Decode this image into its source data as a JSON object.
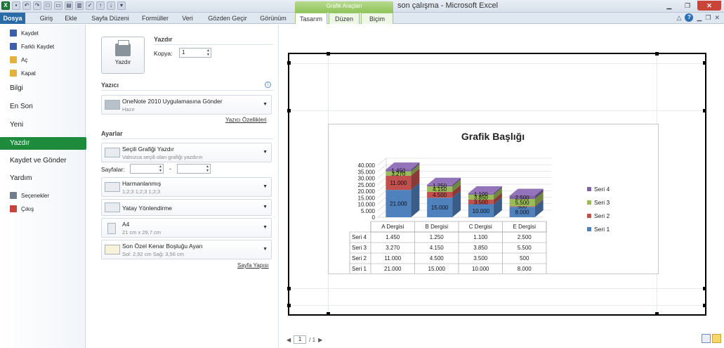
{
  "titlebar": {
    "context_group": "Grafik Araçları",
    "window_title": "son çalışma - Microsoft Excel"
  },
  "tabs": [
    {
      "label": "Dosya"
    },
    {
      "label": "Giriş"
    },
    {
      "label": "Ekle"
    },
    {
      "label": "Sayfa Düzeni"
    },
    {
      "label": "Formüller"
    },
    {
      "label": "Veri"
    },
    {
      "label": "Gözden Geçir"
    },
    {
      "label": "Görünüm"
    },
    {
      "label": "Tasarım"
    },
    {
      "label": "Düzen"
    },
    {
      "label": "Biçim"
    }
  ],
  "leftmenu": {
    "small_items": [
      {
        "label": "Kaydet",
        "icon": "save-icon",
        "color": "#3b5fa8"
      },
      {
        "label": "Farklı Kaydet",
        "icon": "save-as-icon",
        "color": "#3b5fa8"
      },
      {
        "label": "Aç",
        "icon": "open-folder-icon",
        "color": "#e3b23c"
      },
      {
        "label": "Kapat",
        "icon": "close-folder-icon",
        "color": "#e3b23c"
      }
    ],
    "big_items": [
      {
        "label": "Bilgi"
      },
      {
        "label": "En Son"
      },
      {
        "label": "Yeni"
      },
      {
        "label": "Yazdır"
      },
      {
        "label": "Kaydet ve Gönder"
      },
      {
        "label": "Yardım"
      }
    ],
    "bottom_items": [
      {
        "label": "Seçenekler",
        "icon": "options-icon",
        "color": "#6f7c8c"
      },
      {
        "label": "Çıkış",
        "icon": "exit-icon",
        "color": "#c6453a"
      }
    ]
  },
  "print": {
    "section_title": "Yazdır",
    "button_label": "Yazdır",
    "copies_label": "Kopya:",
    "copies_value": "1",
    "printer_section": "Yazıcı",
    "printer_name": "OneNote 2010 Uygulamasına Gönder",
    "printer_status": "Hazır",
    "printer_props_link": "Yazıcı Özellikleri",
    "settings_section": "Ayarlar",
    "what_title": "Seçili Grafiği Yazdır",
    "what_sub": "Valnızca seçili olan grafiği yazdırın",
    "pages_label": "Sayfalar:",
    "pages_dash": "-",
    "collate_title": "Harmanlanmış",
    "collate_sub": "1;2;3    1;2;3    1;2;3",
    "orientation_title": "Yatay Yönlendirme",
    "paper_title": "A4",
    "paper_sub": "21 cm x 29,7 cm",
    "margins_title": "Son Özel Kenar Boşluğu Ayarı",
    "margins_sub": "Sol:  2,92 cm    Sağ:  3,56 cm",
    "page_setup_link": "Sayfa Yapısı"
  },
  "preview_nav": {
    "current_page": "1",
    "total": "/ 1"
  },
  "chart_data": {
    "type": "bar",
    "stacked": true,
    "three_d": true,
    "title": "Grafik Başlığı",
    "categories": [
      "A Dergisi",
      "B Dergisi",
      "C Dergisi",
      "E Dergisi"
    ],
    "y_ticks": [
      "40.000",
      "35.000",
      "30.000",
      "25.000",
      "20.000",
      "15.000",
      "10.000",
      "5.000",
      "0"
    ],
    "ylim": [
      0,
      40000
    ],
    "legend_position": "right",
    "grid": true,
    "series": [
      {
        "name": "Seri 1",
        "color": "#4f81bd",
        "values": [
          21000,
          15000,
          10000,
          8000
        ],
        "labels": [
          "21.000",
          "15.000",
          "10.000",
          "8.000"
        ]
      },
      {
        "name": "Seri 2",
        "color": "#c0504d",
        "values": [
          11000,
          4500,
          3500,
          500
        ],
        "labels": [
          "11.000",
          "4.500",
          "3.500",
          "500"
        ]
      },
      {
        "name": "Seri 3",
        "color": "#9bbb59",
        "values": [
          3270,
          4150,
          3850,
          5500
        ],
        "labels": [
          "3.270",
          "4.150",
          "3.850",
          "5.500"
        ]
      },
      {
        "name": "Seri 4",
        "color": "#8064a2",
        "values": [
          1450,
          1250,
          1100,
          2500
        ],
        "labels": [
          "1.450",
          "1.250",
          "1.100",
          "2.500"
        ]
      }
    ]
  }
}
